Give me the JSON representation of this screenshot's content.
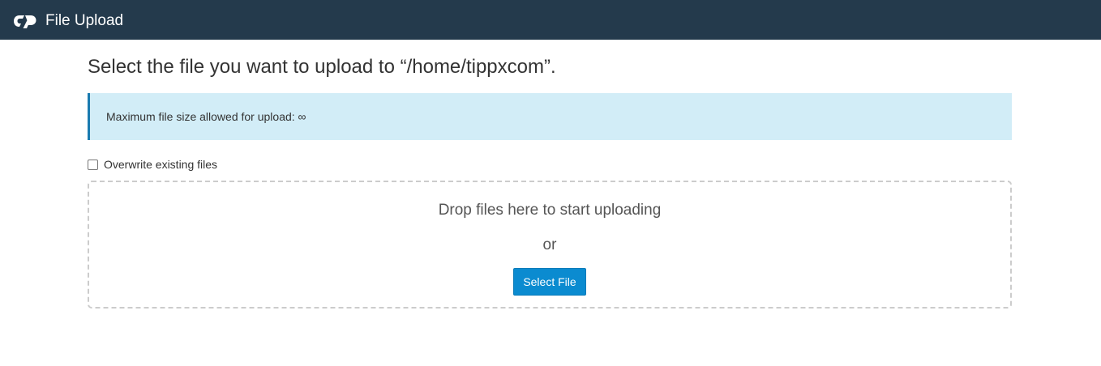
{
  "header": {
    "logo_icon": "cpanel-logo-icon",
    "title": "File Upload",
    "background": "#243a4c"
  },
  "main": {
    "heading": "Select the file you want to upload to “/home/tippxcom”.",
    "info_alert": {
      "text": "Maximum file size allowed for upload: ∞",
      "background": "#d2edf7",
      "accent": "#1a7bb0"
    },
    "overwrite": {
      "label": "Overwrite existing files",
      "checked": false
    },
    "dropzone": {
      "prompt": "Drop files here to start uploading",
      "or_label": "or",
      "select_button_label": "Select File",
      "button_color": "#0b8bd0"
    }
  }
}
